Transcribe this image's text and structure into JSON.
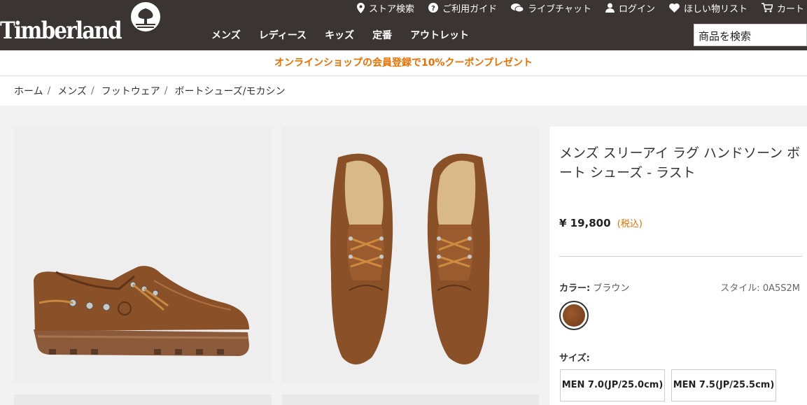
{
  "header": {
    "logo_text": "Timberland",
    "utility": [
      {
        "label": "ストア検索",
        "icon": "map-pin-icon"
      },
      {
        "label": "ご利用ガイド",
        "icon": "question-circle-icon"
      },
      {
        "label": "ライブチャット",
        "icon": "chat-bubbles-icon"
      },
      {
        "label": "ログイン",
        "icon": "user-icon"
      },
      {
        "label": "ほしい物リスト",
        "icon": "heart-icon"
      },
      {
        "label": "カート",
        "icon": "cart-icon"
      }
    ],
    "nav": [
      "メンズ",
      "レディース",
      "キッズ",
      "定番",
      "アウトレット"
    ],
    "search_placeholder": "商品を検索"
  },
  "promo": "オンラインショップの会員登録で10%クーポンプレゼント",
  "breadcrumb": [
    "ホーム",
    "メンズ",
    "フットウェア",
    "ボートシューズ/モカシン"
  ],
  "product": {
    "title": "メンズ スリーアイ ラグ ハンドソーン ボート シューズ - ラスト",
    "price": "¥ 19,800",
    "tax_note": "(税込)",
    "color_label": "カラー:",
    "color_value": "ブラウン",
    "style_label": "スタイル:",
    "style_value": "0A5S2M",
    "size_label": "サイズ:",
    "sizes": [
      "MEN 7.0(JP/25.0cm)",
      "MEN 7.5(JP/25.5cm)"
    ]
  },
  "colors": {
    "header_bg": "#3a3433",
    "promo_orange": "#e86f00",
    "shoe_brown": "#8a5028"
  }
}
